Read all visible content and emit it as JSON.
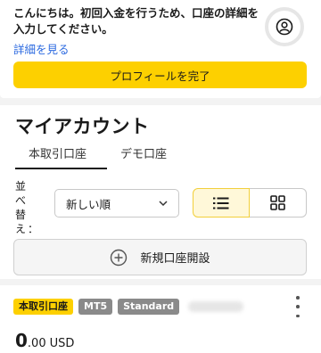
{
  "banner": {
    "message": "こんにちは。初回入金を行うため、口座の詳細を入力してください。",
    "details_link": "詳細を見る",
    "complete_profile_button": "プロフィールを完了"
  },
  "accounts": {
    "title": "マイアカウント",
    "tabs": [
      {
        "label": "本取引口座",
        "active": true
      },
      {
        "label": "デモ口座",
        "active": false
      }
    ],
    "sort_label": "並べ替え：",
    "sort_value": "新しい順",
    "view_mode": "list",
    "open_account_button": "新規口座開設"
  },
  "account_card": {
    "badges": {
      "type": "本取引口座",
      "platform": "MT5",
      "kind": "Standard"
    },
    "balance_integer": "0",
    "balance_decimal": ".00",
    "currency": "USD"
  },
  "colors": {
    "accent_yellow": "#fdd000",
    "link_blue": "#2c6ae0",
    "badge_gray": "#8a8a8a"
  },
  "icons": [
    "user-icon",
    "chevron-down-icon",
    "list-view-icon",
    "grid-view-icon",
    "plus-circle-icon",
    "more-vertical-icon"
  ]
}
